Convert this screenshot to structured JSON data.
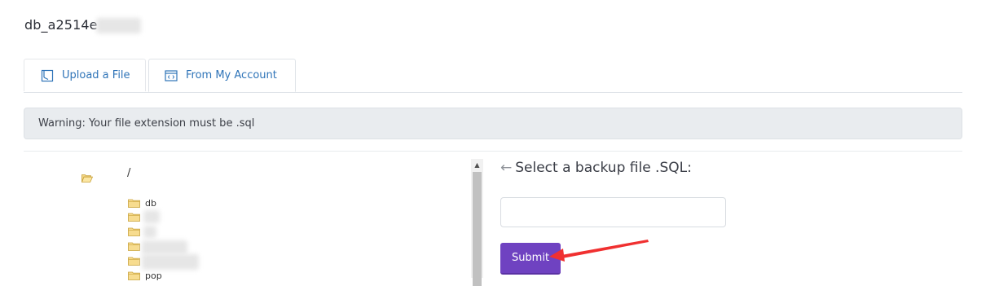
{
  "database": {
    "title": "db_a2514e"
  },
  "tabs": [
    {
      "label": "Upload a File",
      "icon": "upload-file-icon"
    },
    {
      "label": "From My Account",
      "icon": "code-window-icon"
    }
  ],
  "warning": {
    "text": "Warning: Your file extension must be .sql"
  },
  "file_tree": {
    "root_label": "/",
    "items": [
      {
        "label": "db"
      },
      {
        "label": ""
      },
      {
        "label": ""
      },
      {
        "label": ""
      },
      {
        "label": ""
      },
      {
        "label": "pop"
      }
    ]
  },
  "backup": {
    "heading": "Select a backup file  .SQL:",
    "input_value": "",
    "input_placeholder": "",
    "submit_label": "Submit"
  },
  "colors": {
    "accent": "#6f42c1",
    "tab_text": "#2f74b8",
    "warning_bg": "#e9ecef",
    "annotation_arrow": "#f03030"
  }
}
